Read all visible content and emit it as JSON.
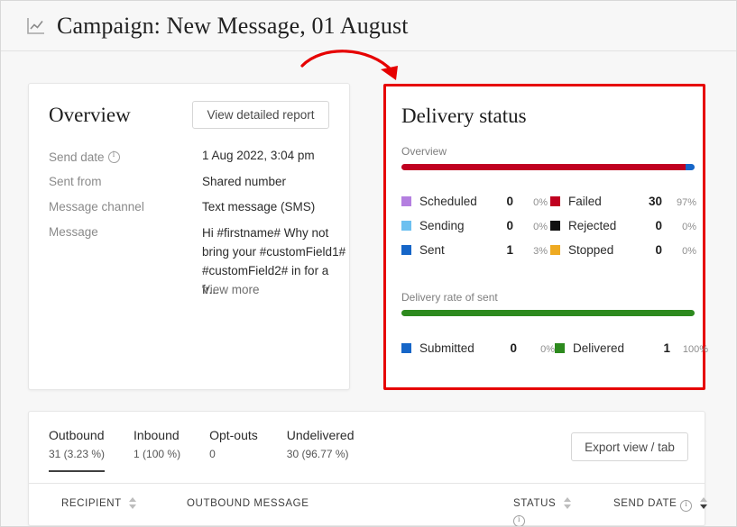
{
  "header": {
    "icon": "line-chart-icon",
    "title": "Campaign: New Message, 01 August"
  },
  "overview": {
    "title": "Overview",
    "detail_button": "View detailed report",
    "fields": [
      {
        "label": "Send date",
        "value": "1 Aug 2022, 3:04 pm",
        "has_info": true
      },
      {
        "label": "Sent from",
        "value": "Shared number",
        "has_info": false
      },
      {
        "label": "Message channel",
        "value": "Text message (SMS)",
        "has_info": false
      },
      {
        "label": "Message",
        "value": "",
        "has_info": false
      }
    ],
    "message_body": "Hi #firstname# Why not bring your #customField1# #customField2# in for a fr...",
    "view_more": "View more"
  },
  "delivery_status": {
    "title": "Delivery status",
    "overview_label": "Overview",
    "rate_label": "Delivery rate of sent",
    "overview_bar": [
      {
        "name": "Failed",
        "percent": 97,
        "color": "#c00020"
      },
      {
        "name": "Sent",
        "percent": 3,
        "color": "#1666c8"
      }
    ],
    "rate_bar": [
      {
        "name": "Delivered",
        "percent": 100,
        "color": "#2d8a1e"
      }
    ],
    "legend_main": [
      {
        "name": "Scheduled",
        "count": "0",
        "percent": "0%",
        "color": "#b47fe0"
      },
      {
        "name": "Failed",
        "count": "30",
        "percent": "97%",
        "color": "#c00020"
      },
      {
        "name": "Sending",
        "count": "0",
        "percent": "0%",
        "color": "#6cc0f0"
      },
      {
        "name": "Rejected",
        "count": "0",
        "percent": "0%",
        "color": "#111111"
      },
      {
        "name": "Sent",
        "count": "1",
        "percent": "3%",
        "color": "#1666c8"
      },
      {
        "name": "Stopped",
        "count": "0",
        "percent": "0%",
        "color": "#eeaa22"
      }
    ],
    "legend_rate": [
      {
        "name": "Submitted",
        "count": "0",
        "percent": "0%",
        "color": "#1666c8"
      },
      {
        "name": "Delivered",
        "count": "1",
        "percent": "100%",
        "color": "#2d8a1e"
      }
    ]
  },
  "table_panel": {
    "tabs": [
      {
        "label": "Outbound",
        "sub": "31 (3.23 %)",
        "active": true
      },
      {
        "label": "Inbound",
        "sub": "1 (100 %)",
        "active": false
      },
      {
        "label": "Opt-outs",
        "sub": "0",
        "active": false
      },
      {
        "label": "Undelivered",
        "sub": "30 (96.77 %)",
        "active": false
      }
    ],
    "export_button": "Export view / tab",
    "columns": [
      {
        "label": "RECIPIENT",
        "sortable": true,
        "info": false,
        "sort": "none"
      },
      {
        "label": "OUTBOUND MESSAGE",
        "sortable": false,
        "info": false,
        "sort": "none"
      },
      {
        "label": "STATUS",
        "sortable": true,
        "info": true,
        "sort": "none"
      },
      {
        "label": "SEND DATE",
        "sortable": true,
        "info": true,
        "sort": "desc"
      }
    ]
  },
  "annotation": {
    "type": "curved-arrow",
    "color": "#e60000",
    "points_to": "delivery-status-card"
  }
}
